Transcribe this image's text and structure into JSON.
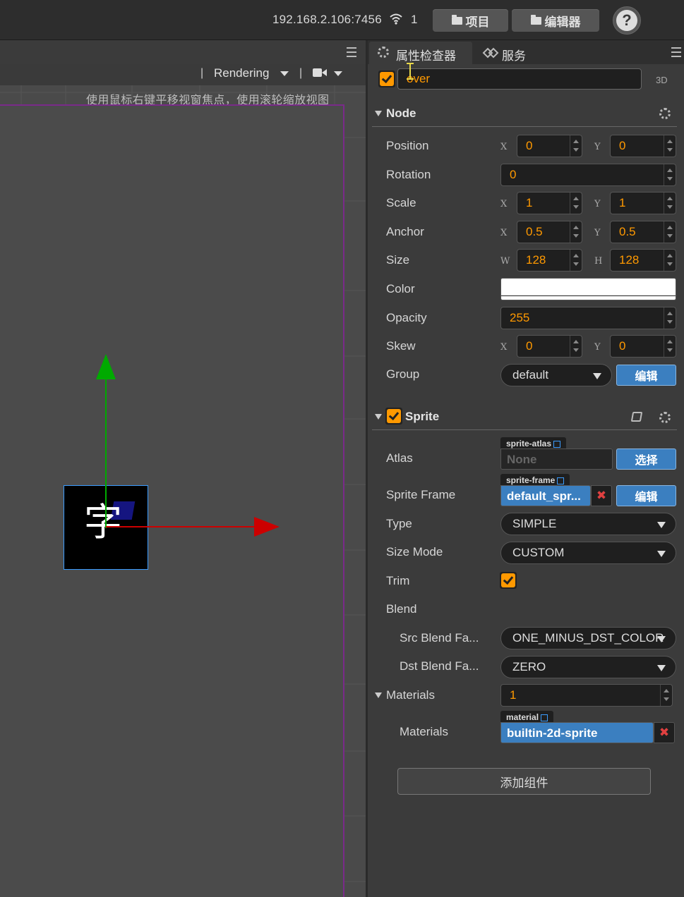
{
  "topbar": {
    "ip": "192.168.2.106:7456",
    "connections": "1",
    "project_btn": "项目",
    "editor_btn": "编辑器",
    "help": "?"
  },
  "scene": {
    "rendering_label": "Rendering",
    "separator": "|",
    "hint": "使用鼠标右键平移视窗焦点，使用滚轮缩放视图",
    "sprite_glyph": "字"
  },
  "inspector": {
    "tabs": [
      {
        "label": "属性检查器",
        "icon": "gear-icon"
      },
      {
        "label": "服务",
        "icon": "service-icon"
      }
    ],
    "node_name": "cover",
    "node_name_visible": "over",
    "active": true,
    "label_3d": "3D",
    "node_section": {
      "title": "Node",
      "position": {
        "label": "Position",
        "x_axis": "X",
        "y_axis": "Y",
        "x": "0",
        "y": "0"
      },
      "rotation": {
        "label": "Rotation",
        "value": "0"
      },
      "scale": {
        "label": "Scale",
        "x_axis": "X",
        "y_axis": "Y",
        "x": "1",
        "y": "1"
      },
      "anchor": {
        "label": "Anchor",
        "x_axis": "X",
        "y_axis": "Y",
        "x": "0.5",
        "y": "0.5"
      },
      "size": {
        "label": "Size",
        "w_axis": "W",
        "h_axis": "H",
        "w": "128",
        "h": "128"
      },
      "color": {
        "label": "Color",
        "value": "#ffffff"
      },
      "opacity": {
        "label": "Opacity",
        "value": "255"
      },
      "skew": {
        "label": "Skew",
        "x_axis": "X",
        "y_axis": "Y",
        "x": "0",
        "y": "0"
      },
      "group": {
        "label": "Group",
        "value": "default",
        "edit_btn": "编辑"
      }
    },
    "sprite_section": {
      "title": "Sprite",
      "enabled": true,
      "atlas": {
        "label": "Atlas",
        "tag": "sprite-atlas",
        "value": "None",
        "btn": "选择"
      },
      "sprite_frame": {
        "label": "Sprite Frame",
        "tag": "sprite-frame",
        "value": "default_spr...",
        "remove": "✖",
        "btn": "编辑"
      },
      "type": {
        "label": "Type",
        "value": "SIMPLE"
      },
      "size_mode": {
        "label": "Size Mode",
        "value": "CUSTOM"
      },
      "trim": {
        "label": "Trim",
        "checked": true
      },
      "blend": {
        "label": "Blend"
      },
      "src_blend": {
        "label": "Src Blend Fa...",
        "value": "ONE_MINUS_DST_COLOR"
      },
      "dst_blend": {
        "label": "Dst Blend Fa...",
        "value": "ZERO"
      },
      "materials_count": {
        "label": "Materials",
        "value": "1"
      },
      "materials_item": {
        "label": "Materials",
        "tag": "material",
        "value": "builtin-2d-sprite",
        "remove": "✖"
      }
    },
    "add_component": "添加组件"
  },
  "colors": {
    "accent": "#ff9900",
    "selected": "#3b7fc0",
    "x_axis": "#cc0000",
    "y_axis": "#00aa00"
  }
}
